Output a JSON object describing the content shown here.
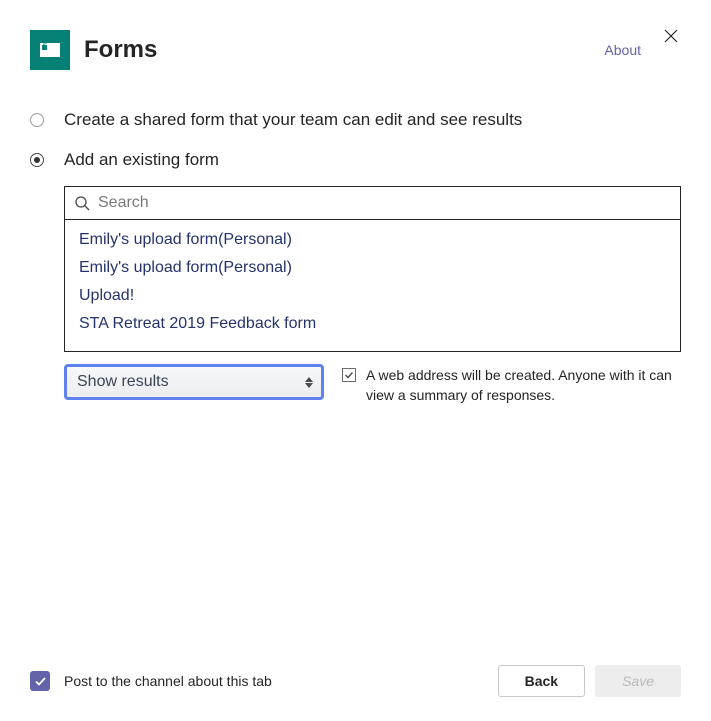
{
  "header": {
    "title": "Forms",
    "about": "About"
  },
  "options": {
    "create": "Create a shared form that your team can edit and see results",
    "existing": "Add an existing form"
  },
  "search": {
    "placeholder": "Search"
  },
  "forms": [
    "Emily's upload form(Personal)",
    "Emily's upload form(Personal)",
    "Upload!",
    "STA Retreat 2019 Feedback form"
  ],
  "display_select": {
    "value": "Show results"
  },
  "web_address": {
    "description": "A web address will be created. Anyone with it can view a summary of responses."
  },
  "footer": {
    "post_label": "Post to the channel about this tab",
    "back": "Back",
    "save": "Save"
  }
}
